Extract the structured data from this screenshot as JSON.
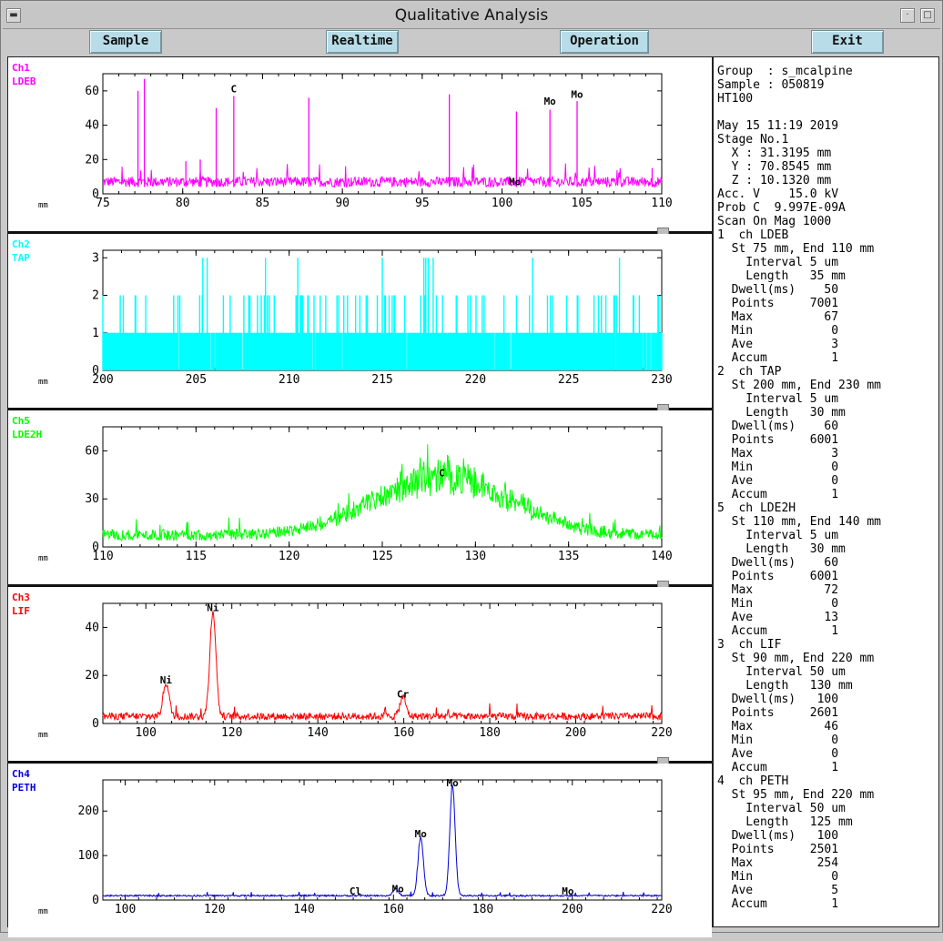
{
  "window": {
    "title": "Qualitative Analysis"
  },
  "toolbar": {
    "sample": "Sample",
    "realtime": "Realtime",
    "operation": "Operation",
    "exit": "Exit"
  },
  "panels": [
    {
      "ch": "Ch1",
      "crystal": "LDEB",
      "color": "#ff00ff",
      "xmin": 75,
      "xmax": 110,
      "xticks": [
        75,
        80,
        85,
        90,
        95,
        100,
        105,
        110
      ],
      "ymax": 70,
      "yticks": [
        0,
        20,
        40,
        60
      ],
      "baseline": 4,
      "noise": 6,
      "peakShape": "line",
      "peakWidth": 0.05,
      "sparse": false,
      "bars": false,
      "peaks": [
        {
          "x": 77.2,
          "y": 60
        },
        {
          "x": 77.6,
          "y": 67
        },
        {
          "x": 80.2,
          "y": 19
        },
        {
          "x": 81.1,
          "y": 20
        },
        {
          "x": 82.1,
          "y": 50
        },
        {
          "x": 83.2,
          "y": 57
        },
        {
          "x": 87.9,
          "y": 56
        },
        {
          "x": 96.7,
          "y": 58
        },
        {
          "x": 100.9,
          "y": 48
        },
        {
          "x": 103.0,
          "y": 49
        },
        {
          "x": 104.7,
          "y": 54
        },
        {
          "x": 109.4,
          "y": 15
        }
      ],
      "labels": [
        {
          "x": 83.2,
          "y": 58,
          "text": "C"
        },
        {
          "x": 103.0,
          "y": 51,
          "text": "Mo"
        },
        {
          "x": 104.7,
          "y": 55,
          "text": "Mo"
        },
        {
          "x": 100.8,
          "y": 4,
          "text": "Mo"
        }
      ]
    },
    {
      "ch": "Ch2",
      "crystal": "TAP",
      "color": "#00ffff",
      "xmin": 200,
      "xmax": 230,
      "xticks": [
        200,
        205,
        210,
        215,
        220,
        225,
        230
      ],
      "ymax": 3.2,
      "yticks": [
        0,
        1,
        2,
        3
      ],
      "baseline": 0,
      "noise": 0,
      "peakShape": "line",
      "peakWidth": 0,
      "sparse": false,
      "bars": true,
      "peaks": [],
      "labels": []
    },
    {
      "ch": "Ch5",
      "crystal": "LDE2H",
      "color": "#00ff00",
      "xmin": 110,
      "xmax": 140,
      "xticks": [
        110,
        115,
        120,
        125,
        130,
        135,
        140
      ],
      "ymax": 75,
      "yticks": [
        0,
        30,
        60
      ],
      "baseline": 4,
      "noise": 7,
      "peakShape": "broad",
      "peakWidth": 3.6,
      "sparse": false,
      "bars": false,
      "peaks": [
        {
          "x": 128.2,
          "y": 36
        }
      ],
      "labels": [
        {
          "x": 128.2,
          "y": 43,
          "text": "C"
        }
      ]
    },
    {
      "ch": "Ch3",
      "crystal": "LIF",
      "color": "#ff0000",
      "xmin": 90,
      "xmax": 220,
      "xticks": [
        100,
        120,
        140,
        160,
        180,
        200,
        220
      ],
      "ymax": 50,
      "yticks": [
        0,
        20,
        40
      ],
      "baseline": 1.5,
      "noise": 3,
      "peakShape": "sharp",
      "peakWidth": 0.7,
      "sparse": false,
      "bars": false,
      "peaks": [
        {
          "x": 104.7,
          "y": 14
        },
        {
          "x": 115.6,
          "y": 44
        },
        {
          "x": 159.8,
          "y": 8
        }
      ],
      "labels": [
        {
          "x": 104.7,
          "y": 16,
          "text": "Ni"
        },
        {
          "x": 115.6,
          "y": 46,
          "text": "Ni"
        },
        {
          "x": 159.8,
          "y": 10,
          "text": "Cr"
        }
      ]
    },
    {
      "ch": "Ch4",
      "crystal": "PETH",
      "color": "#0000dd",
      "xmin": 95,
      "xmax": 220,
      "xticks": [
        100,
        120,
        140,
        160,
        180,
        200,
        220
      ],
      "ymax": 270,
      "yticks": [
        0,
        100,
        200
      ],
      "baseline": 8,
      "noise": 6,
      "peakShape": "sharp",
      "peakWidth": 0.6,
      "sparse": true,
      "bars": false,
      "peaks": [
        {
          "x": 160.5,
          "y": 15
        },
        {
          "x": 166.1,
          "y": 130
        },
        {
          "x": 173.2,
          "y": 246
        }
      ],
      "labels": [
        {
          "x": 151.5,
          "y": 8,
          "text": "Cl"
        },
        {
          "x": 161.0,
          "y": 13,
          "text": "Mo"
        },
        {
          "x": 166.1,
          "y": 137,
          "text": "Mo"
        },
        {
          "x": 173.2,
          "y": 252,
          "text": "Mo"
        },
        {
          "x": 199.0,
          "y": 8,
          "text": "Mo"
        }
      ]
    }
  ],
  "axis_unit": "mm",
  "info": {
    "lines": [
      "Group  : s_mcalpine",
      "Sample : 050819",
      "HT100",
      "",
      "May 15 11:19 2019",
      "Stage No.1",
      "  X : 31.3195 mm",
      "  Y : 70.8545 mm",
      "  Z : 10.1320 mm",
      "Acc. V    15.0 kV",
      "Prob C  9.997E-09A",
      "Scan On Mag 1000",
      "1  ch LDEB",
      "  St 75 mm, End 110 mm",
      "    Interval 5 um",
      "    Length   35 mm",
      "  Dwell(ms)    50",
      "  Points     7001",
      "  Max          67",
      "  Min           0",
      "  Ave           3",
      "  Accum         1",
      "2  ch TAP",
      "  St 200 mm, End 230 mm",
      "    Interval 5 um",
      "    Length   30 mm",
      "  Dwell(ms)    60",
      "  Points     6001",
      "  Max           3",
      "  Min           0",
      "  Ave           0",
      "  Accum         1",
      "5  ch LDE2H",
      "  St 110 mm, End 140 mm",
      "    Interval 5 um",
      "    Length   30 mm",
      "  Dwell(ms)    60",
      "  Points     6001",
      "  Max          72",
      "  Min           0",
      "  Ave          13",
      "  Accum         1",
      "3  ch LIF",
      "  St 90 mm, End 220 mm",
      "    Interval 50 um",
      "    Length   130 mm",
      "  Dwell(ms)   100",
      "  Points     2601",
      "  Max          46",
      "  Min           0",
      "  Ave           0",
      "  Accum         1",
      "4  ch PETH",
      "  St 95 mm, End 220 mm",
      "    Interval 50 um",
      "    Length   125 mm",
      "  Dwell(ms)   100",
      "  Points     2501",
      "  Max         254",
      "  Min           0",
      "  Ave           5",
      "  Accum         1"
    ]
  }
}
